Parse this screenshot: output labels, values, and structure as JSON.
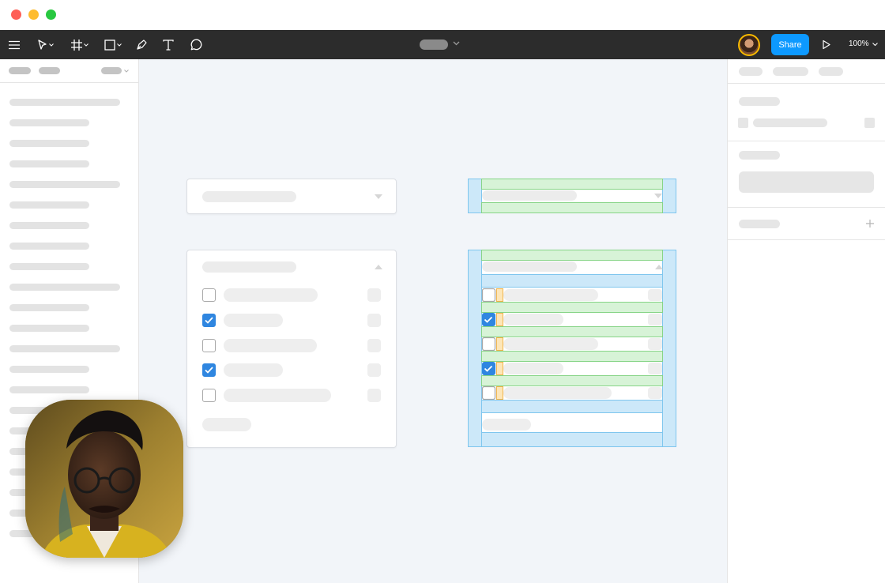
{
  "toolbar": {
    "share_label": "Share",
    "zoom_label": "100%"
  },
  "colors": {
    "toolbar_bg": "#2c2c2c",
    "share_blue": "#0d99ff",
    "checkbox_blue": "#2f86e0",
    "canvas_bg": "#f2f5f9",
    "layout_blue": "#cce8f9",
    "padding_green": "#d7f3d7",
    "gap_orange": "#fde6b8",
    "avatar_ring": "#f5b800"
  },
  "icons": [
    "menu-icon",
    "move-icon",
    "frame-icon",
    "shape-icon",
    "pen-icon",
    "text-icon",
    "comment-icon",
    "play-icon"
  ],
  "plain_list": {
    "checked": [
      false,
      true,
      false,
      true,
      false
    ]
  },
  "annotated_list": {
    "checked": [
      false,
      true,
      false,
      true,
      false
    ]
  }
}
